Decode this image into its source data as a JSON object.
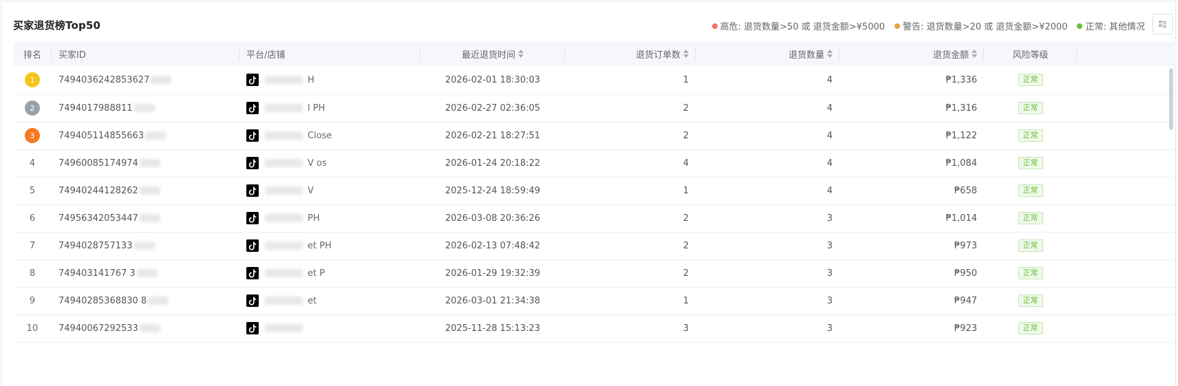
{
  "header": {
    "title": "买家退货榜Top50",
    "legend": [
      {
        "color": "#f56c6c",
        "label": "高危: 退货数量>50 或 退货金额>¥5000"
      },
      {
        "color": "#e6a23c",
        "label": "警告: 退货数量>20 或 退货金额>¥2000"
      },
      {
        "color": "#67c23a",
        "label": "正常: 其他情况"
      }
    ],
    "settings_icon": "column-settings-icon"
  },
  "table": {
    "columns": {
      "rank": "排名",
      "buyer_id": "买家ID",
      "store": "平台/店铺",
      "last_return_time": "最近退货时间",
      "return_orders": "退货订单数",
      "return_qty": "退货数量",
      "return_amount": "退货金额",
      "risk": "风险等级"
    },
    "badge_colors": {
      "1": "#f5c518",
      "2": "#9aa0ab",
      "3": "#f47a20"
    },
    "rows": [
      {
        "rank": "1",
        "buyer_id": "7494036242853627",
        "store": "H",
        "time": "2026-02-01 18:30:03",
        "orders": "1",
        "qty": "4",
        "amount": "₱1,336",
        "risk": "正常"
      },
      {
        "rank": "2",
        "buyer_id": "7494017988811",
        "store": "l PH",
        "time": "2026-02-27 02:36:05",
        "orders": "2",
        "qty": "4",
        "amount": "₱1,316",
        "risk": "正常"
      },
      {
        "rank": "3",
        "buyer_id": "749405114855663",
        "store": "Close",
        "time": "2026-02-21 18:27:51",
        "orders": "2",
        "qty": "4",
        "amount": "₱1,122",
        "risk": "正常"
      },
      {
        "rank": "4",
        "buyer_id": "74960085174974",
        "store": "V os",
        "time": "2026-01-24 20:18:22",
        "orders": "4",
        "qty": "4",
        "amount": "₱1,084",
        "risk": "正常"
      },
      {
        "rank": "5",
        "buyer_id": "74940244128262",
        "store": "V",
        "time": "2025-12-24 18:59:49",
        "orders": "1",
        "qty": "4",
        "amount": "₱658",
        "risk": "正常"
      },
      {
        "rank": "6",
        "buyer_id": "74956342053447",
        "store": "PH",
        "time": "2026-03-08 20:36:26",
        "orders": "2",
        "qty": "3",
        "amount": "₱1,014",
        "risk": "正常"
      },
      {
        "rank": "7",
        "buyer_id": "7494028757133",
        "store": "et PH",
        "time": "2026-02-13 07:48:42",
        "orders": "2",
        "qty": "3",
        "amount": "₱973",
        "risk": "正常"
      },
      {
        "rank": "8",
        "buyer_id": "749403141767 3",
        "store": "et P",
        "time": "2026-01-29 19:32:39",
        "orders": "2",
        "qty": "3",
        "amount": "₱950",
        "risk": "正常"
      },
      {
        "rank": "9",
        "buyer_id": "74940285368830 8",
        "store": "et",
        "time": "2026-03-01 21:34:38",
        "orders": "1",
        "qty": "3",
        "amount": "₱947",
        "risk": "正常"
      },
      {
        "rank": "10",
        "buyer_id": "74940067292533",
        "store": "",
        "time": "2025-11-28 15:13:23",
        "orders": "3",
        "qty": "3",
        "amount": "₱923",
        "risk": "正常"
      }
    ]
  }
}
